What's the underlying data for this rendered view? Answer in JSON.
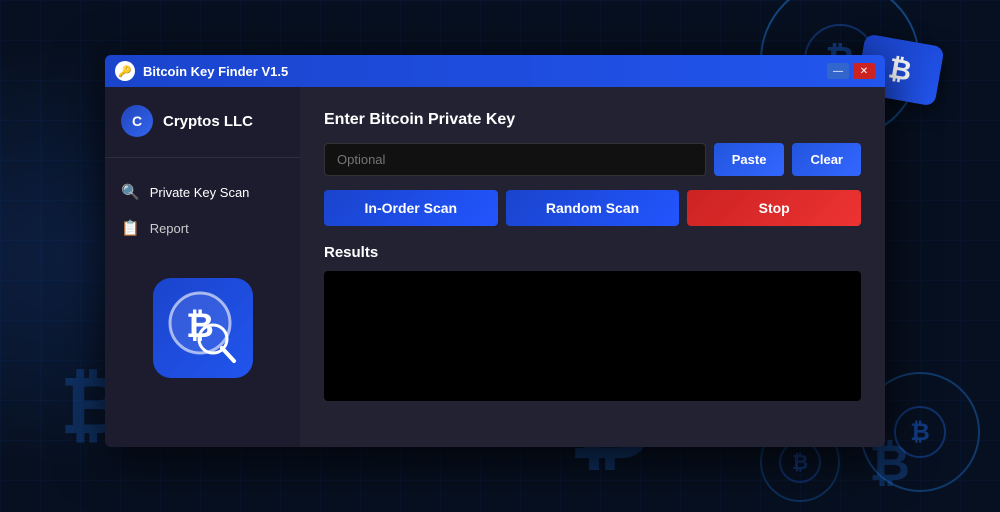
{
  "titleBar": {
    "title": "Bitcoin Key Finder V1.5",
    "minBtn": "—",
    "closeBtn": "✕"
  },
  "sidebar": {
    "brandName": "Cryptos LLC",
    "navItems": [
      {
        "id": "private-key-scan",
        "icon": "🔍",
        "label": "Private Key Scan",
        "active": true
      },
      {
        "id": "report",
        "icon": "📋",
        "label": "Report",
        "active": false
      }
    ]
  },
  "main": {
    "sectionTitle": "Enter Bitcoin Private Key",
    "keyInput": {
      "placeholder": "Optional"
    },
    "pasteBtn": "Paste",
    "clearBtn": "Clear",
    "buttons": [
      {
        "id": "in-order-scan",
        "label": "In-Order Scan"
      },
      {
        "id": "random-scan",
        "label": "Random Scan"
      },
      {
        "id": "stop",
        "label": "Stop"
      }
    ],
    "resultsTitle": "Results"
  }
}
